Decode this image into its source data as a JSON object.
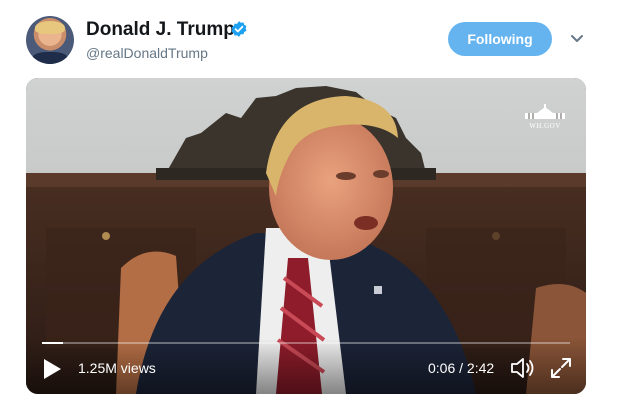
{
  "user": {
    "display_name": "Donald J. Trump",
    "handle": "@realDonaldTrump",
    "verified": true
  },
  "follow_button": {
    "label": "Following"
  },
  "video": {
    "watermark": "WH.GOV",
    "views": "1.25M views",
    "time": "0:06 / 2:42",
    "progress_fraction": 0.04
  },
  "colors": {
    "accent": "#65b4ef",
    "verified": "#1da1f2",
    "handle": "#657786"
  },
  "icons": {
    "verified": "verified-badge-icon",
    "caret": "chevron-down-icon",
    "play": "play-icon",
    "volume": "volume-icon",
    "fullscreen": "fullscreen-icon"
  }
}
